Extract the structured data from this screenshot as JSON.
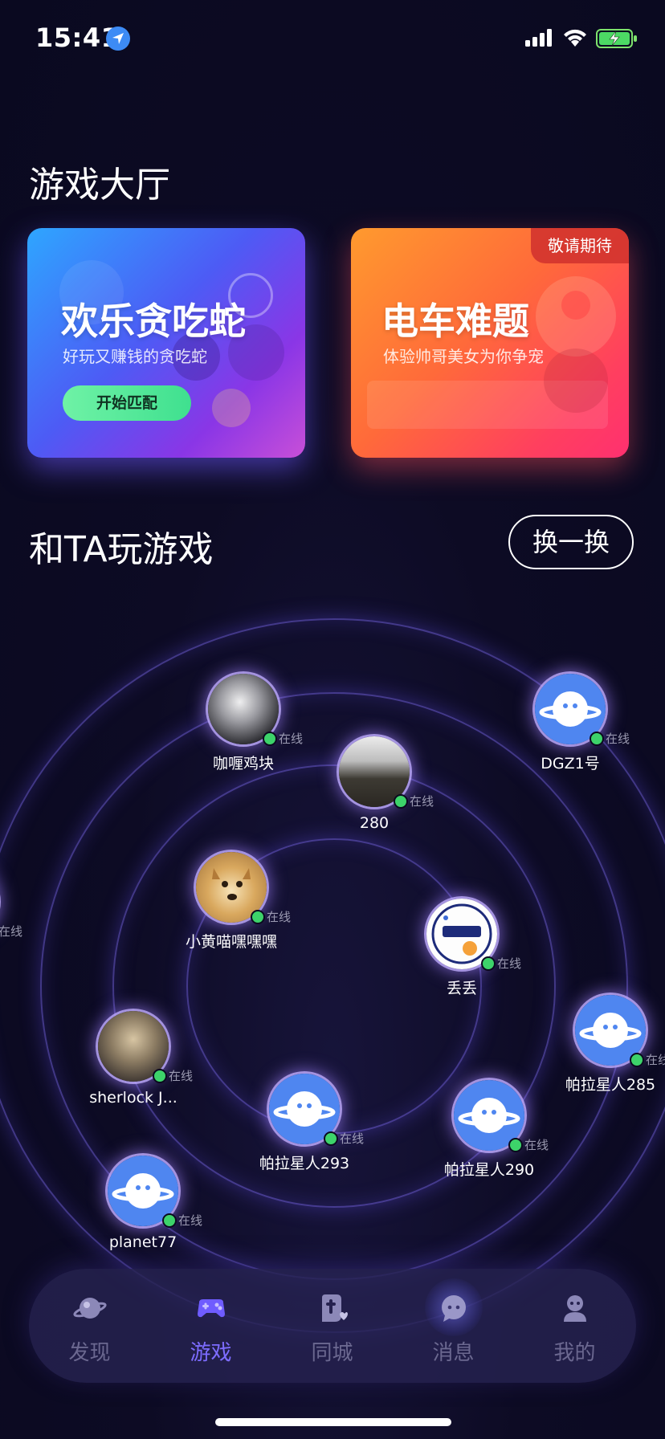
{
  "status_bar": {
    "time": "15:41",
    "icons": [
      "location-icon",
      "signal-icon",
      "wifi-icon",
      "battery-charging-icon"
    ]
  },
  "lobby": {
    "title": "游戏大厅",
    "cards": [
      {
        "title": "欢乐贪吃蛇",
        "subtitle": "好玩又赚钱的贪吃蛇",
        "button": "开始匹配"
      },
      {
        "title": "电车难题",
        "subtitle": "体验帅哥美女为你争宠",
        "badge": "敬请期待"
      }
    ]
  },
  "play_with": {
    "title": "和TA玩游戏",
    "shuffle_label": "换一换",
    "online_label": "在线",
    "users": [
      {
        "name": "咖喱鸡块",
        "online": true,
        "avatar": "photo"
      },
      {
        "name": "DGZ1号",
        "online": true,
        "avatar": "planet-mascot"
      },
      {
        "name": "280",
        "online": true,
        "avatar": "photo"
      },
      {
        "name": "",
        "online": true,
        "avatar": "photo"
      },
      {
        "name": "小黄喵嘿嘿嘿",
        "online": true,
        "avatar": "doge"
      },
      {
        "name": "丢丢",
        "online": true,
        "avatar": "sticker"
      },
      {
        "name": "帕拉星人285",
        "online": true,
        "avatar": "planet-mascot"
      },
      {
        "name": "sherlock  J...",
        "online": true,
        "avatar": "photo"
      },
      {
        "name": "帕拉星人293",
        "online": true,
        "avatar": "planet-mascot"
      },
      {
        "name": "帕拉星人290",
        "online": true,
        "avatar": "planet-mascot"
      },
      {
        "name": "planet77",
        "online": true,
        "avatar": "planet-mascot"
      }
    ]
  },
  "bottom_nav": {
    "active": "游戏",
    "items": [
      {
        "label": "发现",
        "icon": "planet-icon"
      },
      {
        "label": "游戏",
        "icon": "gamepad-icon"
      },
      {
        "label": "同城",
        "icon": "city-icon"
      },
      {
        "label": "消息",
        "icon": "message-icon"
      },
      {
        "label": "我的",
        "icon": "profile-icon"
      }
    ]
  },
  "colors": {
    "background": "#0b0a1f",
    "accent": "#7d6cff",
    "online": "#3dd36a",
    "match_button": "#3fe08f"
  }
}
